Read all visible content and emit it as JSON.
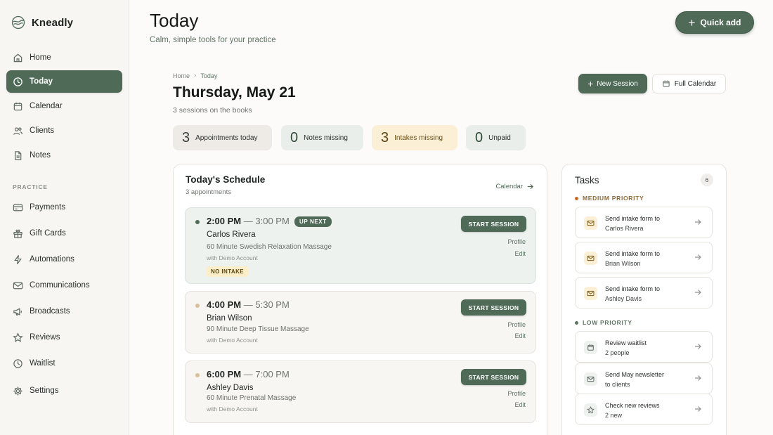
{
  "app": {
    "name": "Kneadly"
  },
  "sidebar": {
    "items": [
      {
        "label": "Home",
        "icon": "home-icon"
      },
      {
        "label": "Today",
        "icon": "clock-icon",
        "active": true
      },
      {
        "label": "Calendar",
        "icon": "calendar-icon"
      },
      {
        "label": "Clients",
        "icon": "users-icon"
      },
      {
        "label": "Notes",
        "icon": "document-icon"
      }
    ],
    "section_label": "PRACTICE",
    "practice_items": [
      {
        "label": "Payments",
        "icon": "credit-card-icon"
      },
      {
        "label": "Gift Cards",
        "icon": "gift-icon"
      },
      {
        "label": "Automations",
        "icon": "lightning-icon"
      },
      {
        "label": "Communications",
        "icon": "mail-icon"
      },
      {
        "label": "Broadcasts",
        "icon": "megaphone-icon"
      },
      {
        "label": "Reviews",
        "icon": "star-icon"
      },
      {
        "label": "Waitlist",
        "icon": "clock-icon"
      },
      {
        "label": "Settings",
        "icon": "gear-icon"
      }
    ]
  },
  "header": {
    "title": "Today",
    "subtitle": "Calm, simple tools for your practice",
    "quick_add_label": "Quick add"
  },
  "breadcrumb": {
    "home": "Home",
    "current": "Today"
  },
  "day": {
    "title": "Thursday, May 21",
    "subtitle": "3 sessions on the books",
    "new_session_label": "New Session",
    "full_calendar_label": "Full Calendar"
  },
  "stats": [
    {
      "value": "3",
      "label": "Appointments today"
    },
    {
      "value": "0",
      "label": "Notes missing"
    },
    {
      "value": "3",
      "label": "Intakes missing"
    },
    {
      "value": "0",
      "label": "Unpaid"
    }
  ],
  "schedule": {
    "title": "Today's Schedule",
    "subtitle": "3 appointments",
    "calendar_link": "Calendar",
    "appointments": [
      {
        "start": "2:00 PM",
        "end": "3:00 PM",
        "badge": "UP NEXT",
        "client": "Carlos Rivera",
        "service": "60 Minute Swedish Relaxation Massage",
        "account": "with Demo Account",
        "tag": "NO INTAKE",
        "start_label": "START SESSION",
        "profile_label": "Profile",
        "edit_label": "Edit",
        "dot_color": "#4f6b58"
      },
      {
        "start": "4:00 PM",
        "end": "5:30 PM",
        "client": "Brian Wilson",
        "service": "90 Minute Deep Tissue Massage",
        "account": "with Demo Account",
        "start_label": "START SESSION",
        "profile_label": "Profile",
        "edit_label": "Edit",
        "dot_color": "#d9bf9a"
      },
      {
        "start": "6:00 PM",
        "end": "7:00 PM",
        "client": "Ashley Davis",
        "service": "60 Minute Prenatal Massage",
        "account": "with Demo Account",
        "start_label": "START SESSION",
        "profile_label": "Profile",
        "edit_label": "Edit",
        "dot_color": "#d9bf9a"
      }
    ]
  },
  "tasks": {
    "title": "Tasks",
    "count": "6",
    "medium_label": "MEDIUM PRIORITY",
    "low_label": "LOW PRIORITY",
    "medium": [
      {
        "line1": "Send intake form to",
        "line2": "Carlos Rivera",
        "icon": "mail-icon"
      },
      {
        "line1": "Send intake form to",
        "line2": "Brian Wilson",
        "icon": "mail-icon"
      },
      {
        "line1": "Send intake form to",
        "line2": "Ashley Davis",
        "icon": "mail-icon"
      }
    ],
    "low": [
      {
        "line1": "Review waitlist",
        "line2": "2 people",
        "icon": "calendar-icon"
      },
      {
        "line1": "Send May newsletter",
        "line2": "to clients",
        "icon": "mail-icon"
      },
      {
        "line1": "Check new reviews",
        "line2": "2 new",
        "icon": "star-icon"
      }
    ]
  },
  "colors": {
    "brand": "#4f6b58",
    "amber_bg": "#fbefd6",
    "sidebar_bg": "#f7f6f3"
  }
}
